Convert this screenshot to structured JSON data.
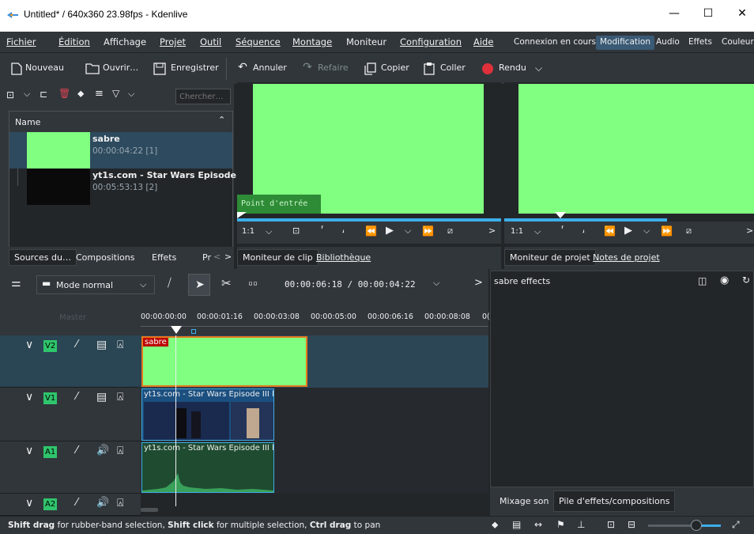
{
  "window": {
    "title": "Untitled* / 640x360 23.98fps - Kdenlive"
  },
  "menu": {
    "items": [
      "Fichier",
      "Édition",
      "Affichage",
      "Projet",
      "Outil",
      "Séquence",
      "Montage",
      "Moniteur",
      "Configuration",
      "Aide"
    ]
  },
  "layouts": {
    "items": [
      "Connexion en cours",
      "Modification",
      "Audio",
      "Effets",
      "Couleur"
    ],
    "active": "Modification"
  },
  "toolbar": {
    "new": "Nouveau",
    "open": "Ouvrir…",
    "save": "Enregistrer",
    "undo": "Annuler",
    "redo": "Refaire",
    "copy": "Copier",
    "paste": "Coller",
    "render": "Rendu"
  },
  "bin": {
    "search_placeholder": "Chercher…",
    "column": "Name",
    "clips": [
      {
        "name": "sabre",
        "info": "00:00:04:22 [1]",
        "thumb_color": "#80ff80"
      },
      {
        "name": "yt1s.com - Star Wars Episode III",
        "info": "00:05:53:13 [2]",
        "thumb_color": "#0a0a0a"
      }
    ],
    "tabs": [
      "Sources du…",
      "Compositions",
      "Effets",
      "Pr"
    ]
  },
  "clip_monitor": {
    "overlay": "Point d'entrée",
    "zoom": "1:1",
    "tabs": [
      "Moniteur de clip",
      "Bibliothèque"
    ]
  },
  "project_monitor": {
    "zoom": "1:1",
    "tabs": [
      "Moniteur de projet",
      "Notes de projet"
    ]
  },
  "timeline": {
    "mode": "Mode normal",
    "timecode": "00:00:06:18 / 00:00:04:22",
    "ruler": [
      "00:00:00:00",
      "00:00:01:16",
      "00:00:03:08",
      "00:00:05:00",
      "00:00:06:16",
      "00:00:08:08",
      "0("
    ],
    "master_label": "Master",
    "tracks": [
      {
        "id": "V2",
        "type": "video"
      },
      {
        "id": "V1",
        "type": "video"
      },
      {
        "id": "A1",
        "type": "audio"
      },
      {
        "id": "A2",
        "type": "audio"
      }
    ],
    "clips": {
      "v2": "sabre",
      "v1": "yt1s.com - Star Wars Episode III l",
      "a1": "yt1s.com - Star Wars Episode III l"
    }
  },
  "effects_panel": {
    "title": "sabre effects",
    "tabs": [
      "Mixage son",
      "Pile d'effets/compositions"
    ]
  },
  "status": {
    "parts": [
      {
        "bold": "Shift drag"
      },
      {
        "text": " for rubber-band selection, "
      },
      {
        "bold": "Shift click"
      },
      {
        "text": " for multiple selection, "
      },
      {
        "bold": "Ctrl drag"
      },
      {
        "text": " to pan"
      }
    ]
  },
  "colors": {
    "accent": "#3daee9",
    "clip_green": "#80ff80",
    "track_green": "#2fc56c",
    "selected_border": "#e5781f",
    "render_red": "#e0303a"
  }
}
